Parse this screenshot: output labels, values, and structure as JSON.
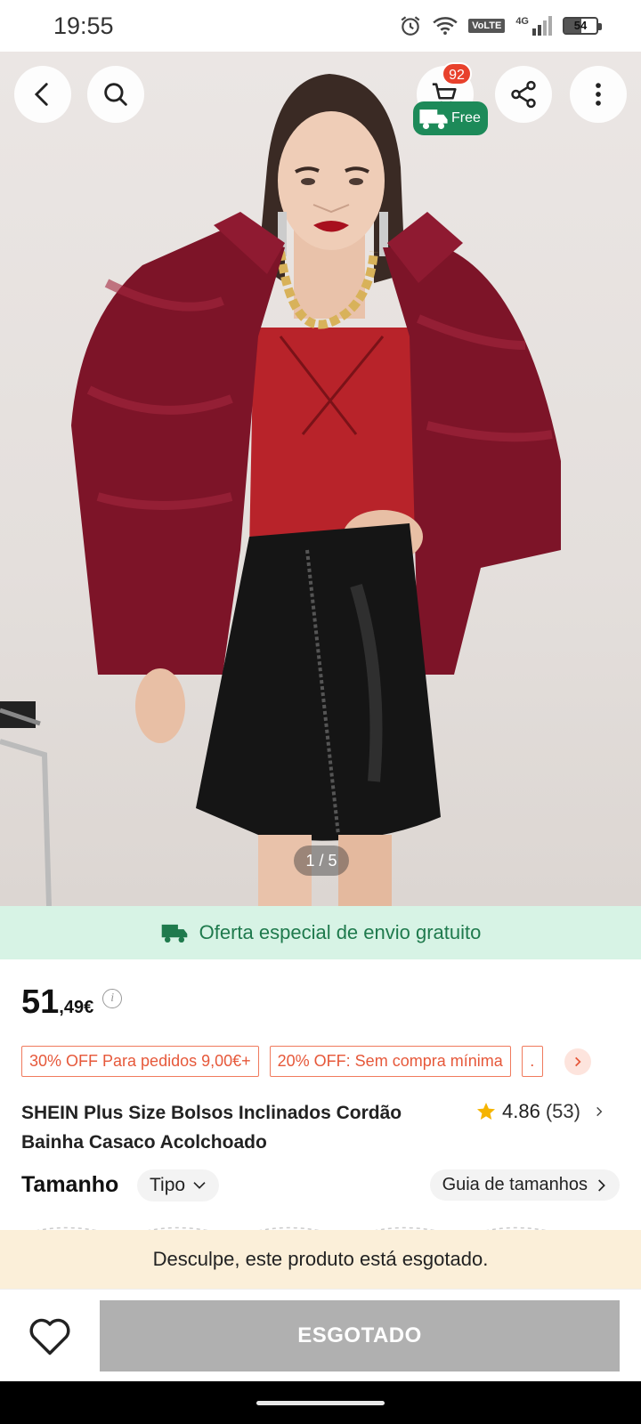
{
  "status_bar": {
    "time": "19:55",
    "network": "4G",
    "volte": "VoLTE",
    "battery": "54"
  },
  "nav": {
    "cart_count": "92",
    "free_label": "Free"
  },
  "gallery": {
    "pager": "1 / 5"
  },
  "shipping_banner": {
    "text": "Oferta especial de envio gratuito"
  },
  "price": {
    "integer": "51",
    "decimal": ",49€",
    "info": "i"
  },
  "coupons": [
    {
      "label": "30% OFF Para pedidos 9,00€+"
    },
    {
      "label": "20% OFF: Sem compra mínima"
    },
    {
      "label": "."
    }
  ],
  "product": {
    "title": "SHEIN Plus Size Bolsos Inclinados Cordão Bainha Casaco Acolchoado",
    "rating": "4.86",
    "rating_count": "(53)"
  },
  "size_section": {
    "label": "Tamanho",
    "type_label": "Tipo",
    "guide_label": "Guia de tamanhos"
  },
  "notice": {
    "text": "Desculpe, este produto está esgotado."
  },
  "bottom_bar": {
    "button_label": "ESGOTADO"
  },
  "colors": {
    "accent": "#e6583a",
    "green": "#1d8a59",
    "banner_bg": "#d7f3e5",
    "notice_bg": "#fbefd9",
    "disabled": "#b0b0b0"
  }
}
